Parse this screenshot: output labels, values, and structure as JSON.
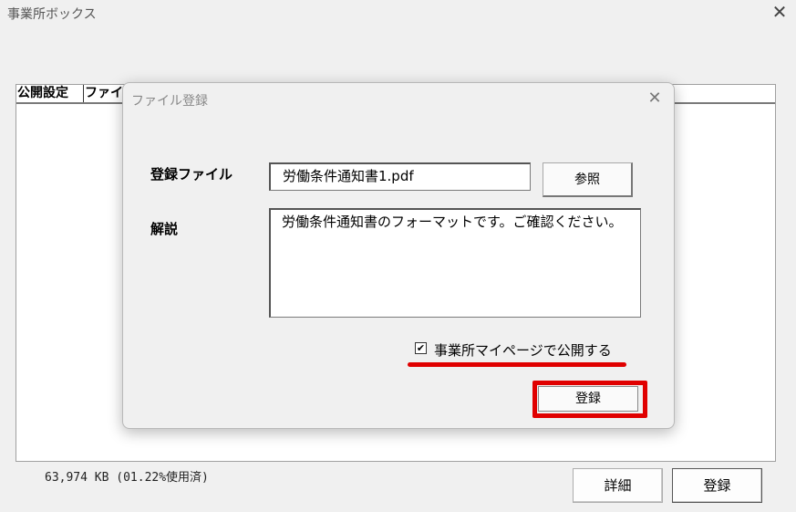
{
  "window": {
    "title": "事業所ボックス",
    "close_icon": "close-icon"
  },
  "list": {
    "columns": [
      "公開設定",
      "ファイ"
    ]
  },
  "storage": {
    "usage_text": "63,974 KB (01.22%使用済)"
  },
  "footer": {
    "detail_label": "詳細",
    "register_label": "登録"
  },
  "modal": {
    "title": "ファイル登録",
    "file_label": "登録ファイル",
    "file_value": "労働条件通知書1.pdf",
    "browse_label": "参照",
    "desc_label": "解説",
    "desc_value": "労働条件通知書のフォーマットです。ご確認ください。",
    "publish_checked": true,
    "publish_label": "事業所マイページで公開する",
    "register_label": "登録"
  },
  "colors": {
    "highlight": "#e00000",
    "background": "#f0f0f0"
  }
}
